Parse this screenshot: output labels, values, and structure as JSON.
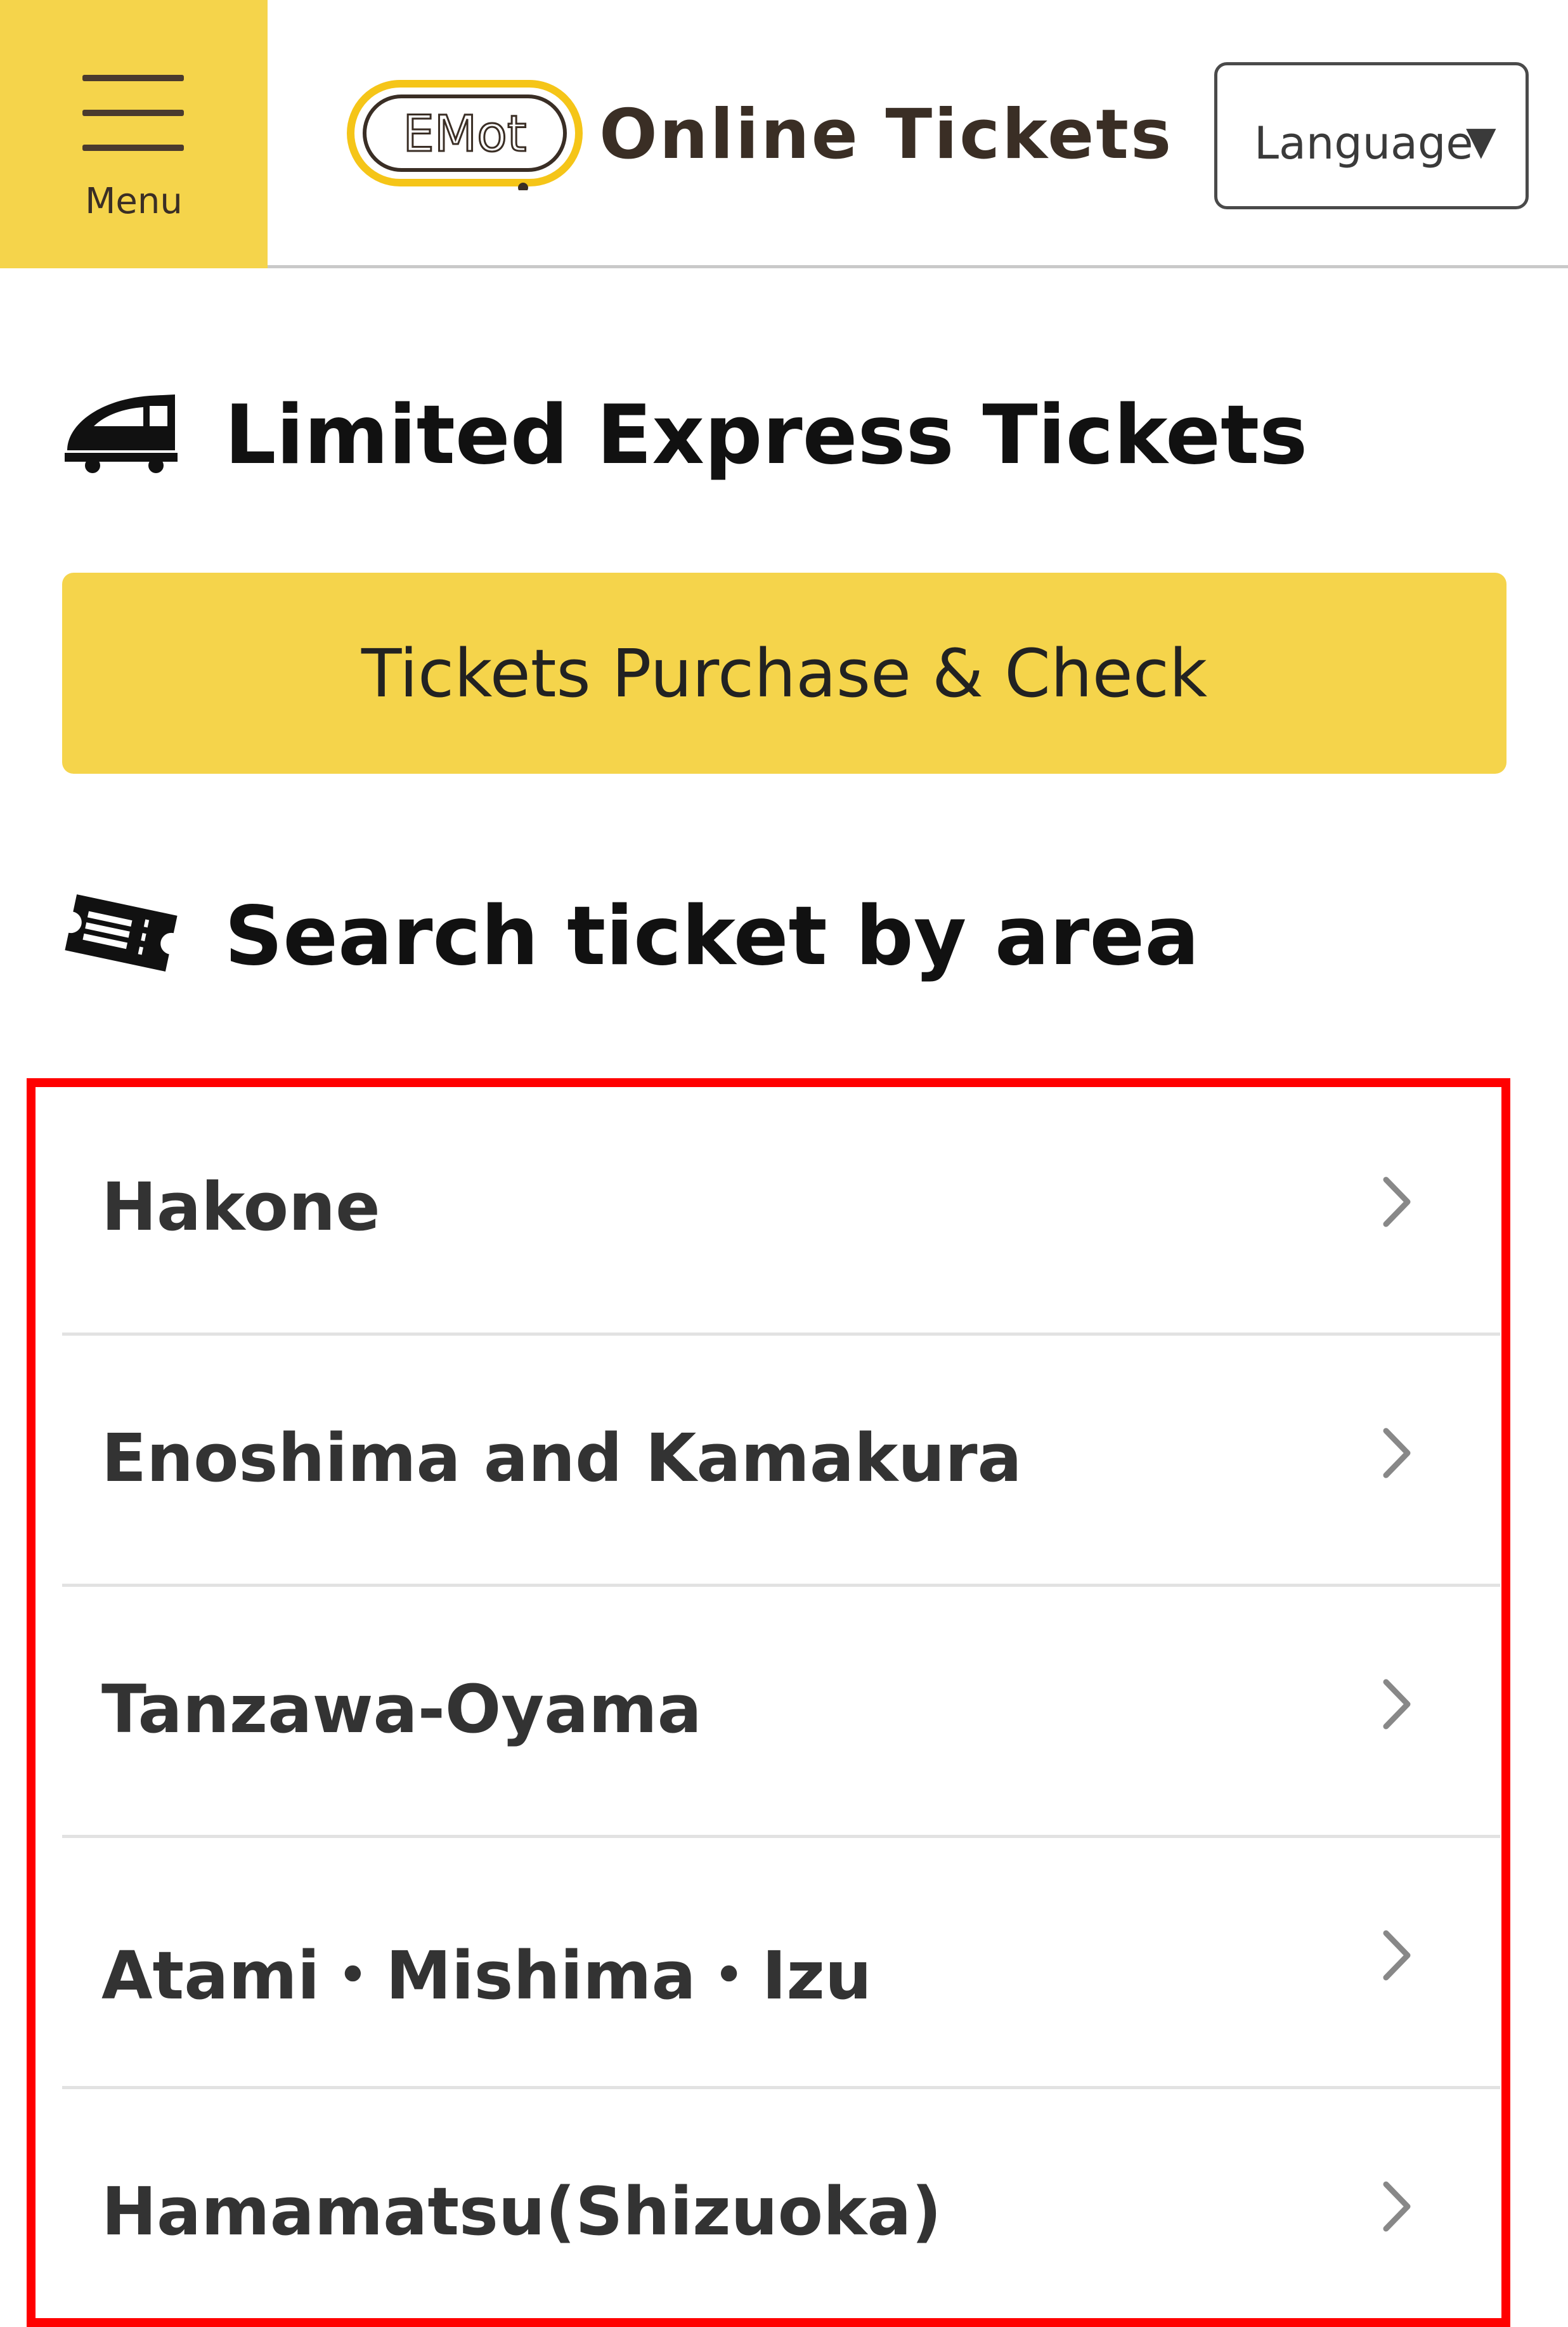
{
  "header": {
    "menu_label": "Menu",
    "logo_text": "EMot",
    "site_title": "Online Tickets",
    "language_label": "Language",
    "language_arrow": "▼"
  },
  "express": {
    "title": "Limited Express Tickets",
    "icon": "train-icon",
    "purchase_button": "Tickets Purchase & Check"
  },
  "area": {
    "title": "Search ticket by area",
    "icon": "ticket-icon",
    "items": [
      {
        "label": "Hakone"
      },
      {
        "label": "Enoshima and Kamakura"
      },
      {
        "label": "Tanzawa-Oyama"
      },
      {
        "label": "Atami・Mishima・Izu"
      },
      {
        "label": "Hamamatsu(Shizuoka)"
      }
    ]
  },
  "colors": {
    "accent": "#f5d44b",
    "brown": "#3a2e25",
    "highlight": "#ff0000"
  }
}
